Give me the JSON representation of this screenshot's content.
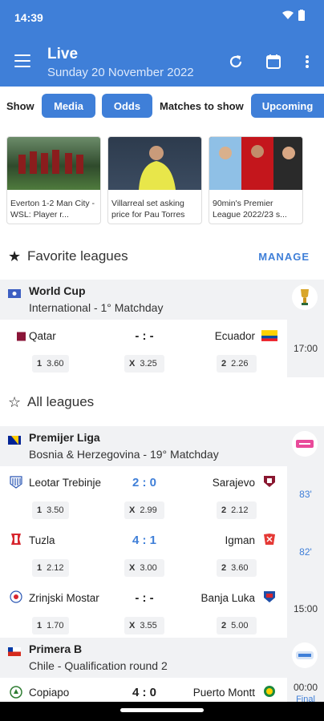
{
  "status": {
    "time": "14:39"
  },
  "header": {
    "title": "Live",
    "subtitle": "Sunday 20 November 2022"
  },
  "filters": {
    "show_label": "Show",
    "media": "Media",
    "odds": "Odds",
    "matches_label": "Matches to show",
    "upcoming": "Upcoming"
  },
  "news": [
    {
      "caption": "Everton 1-2 Man City - WSL: Player r..."
    },
    {
      "caption": "Villarreal set asking price for Pau Torres"
    },
    {
      "caption": "90min's Premier League 2022/23 s..."
    }
  ],
  "favorites": {
    "title": "Favorite leagues",
    "manage": "MANAGE"
  },
  "all_leagues": {
    "title": "All leagues"
  },
  "leagues": [
    {
      "name": "World Cup",
      "sub": "International - 1° Matchday"
    },
    {
      "name": "Premijer Liga",
      "sub": "Bosnia & Herzegovina - 19° Matchday"
    },
    {
      "name": "Primera B",
      "sub": "Chile - Qualification round 2"
    }
  ],
  "matches": [
    {
      "home": "Qatar",
      "away": "Ecuador",
      "score": "- : -",
      "o1": "3.60",
      "ox": "3.25",
      "o2": "2.26",
      "time": "17:00"
    },
    {
      "home": "Leotar Trebinje",
      "away": "Sarajevo",
      "score": "2 : 0",
      "o1": "3.50",
      "ox": "2.99",
      "o2": "2.12",
      "time": "83'"
    },
    {
      "home": "Tuzla",
      "away": "Igman",
      "score": "4 : 1",
      "o1": "2.12",
      "ox": "3.00",
      "o2": "3.60",
      "time": "82'"
    },
    {
      "home": "Zrinjski Mostar",
      "away": "Banja Luka",
      "score": "- : -",
      "o1": "1.70",
      "ox": "3.55",
      "o2": "5.00",
      "time": "15:00"
    },
    {
      "home": "Copiapo",
      "away": "Puerto Montt",
      "score": "4 : 0",
      "time": "00:00",
      "status": "Final"
    }
  ],
  "odds_labels": {
    "one": "1",
    "x": "X",
    "two": "2"
  },
  "colors": {
    "primary": "#3f7fd8",
    "panel": "#f1f2f4"
  }
}
